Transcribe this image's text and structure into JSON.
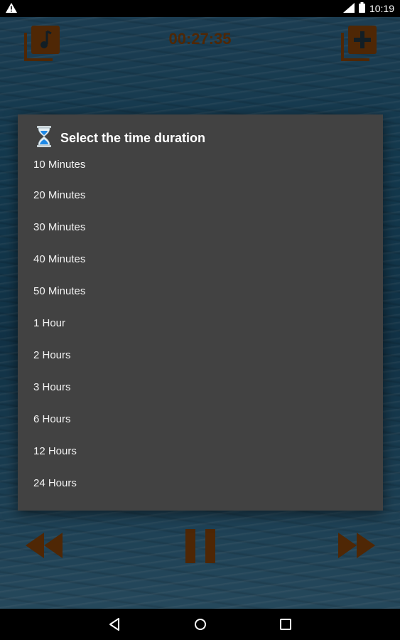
{
  "status_bar": {
    "time": "10:19"
  },
  "player": {
    "timer": "00:27:35"
  },
  "dialog": {
    "title": "Select the time duration",
    "options": [
      "10 Minutes",
      "20 Minutes",
      "30 Minutes",
      "40 Minutes",
      "50 Minutes",
      "1 Hour",
      "2 Hours",
      "3 Hours",
      "6 Hours",
      "12 Hours",
      "24 Hours"
    ]
  },
  "icons": {
    "warning": "warning-icon",
    "signal": "signal-icon",
    "battery": "battery-icon",
    "music": "music-library-icon",
    "add": "add-playlist-icon",
    "hourglass": "hourglass-icon",
    "rewind": "rewind-icon",
    "pause": "pause-icon",
    "fast_forward": "fast-forward-icon",
    "back": "back-icon",
    "home": "home-icon",
    "recents": "recents-icon"
  },
  "colors": {
    "accent": "#7a3d08",
    "dialog_bg": "#424242"
  }
}
